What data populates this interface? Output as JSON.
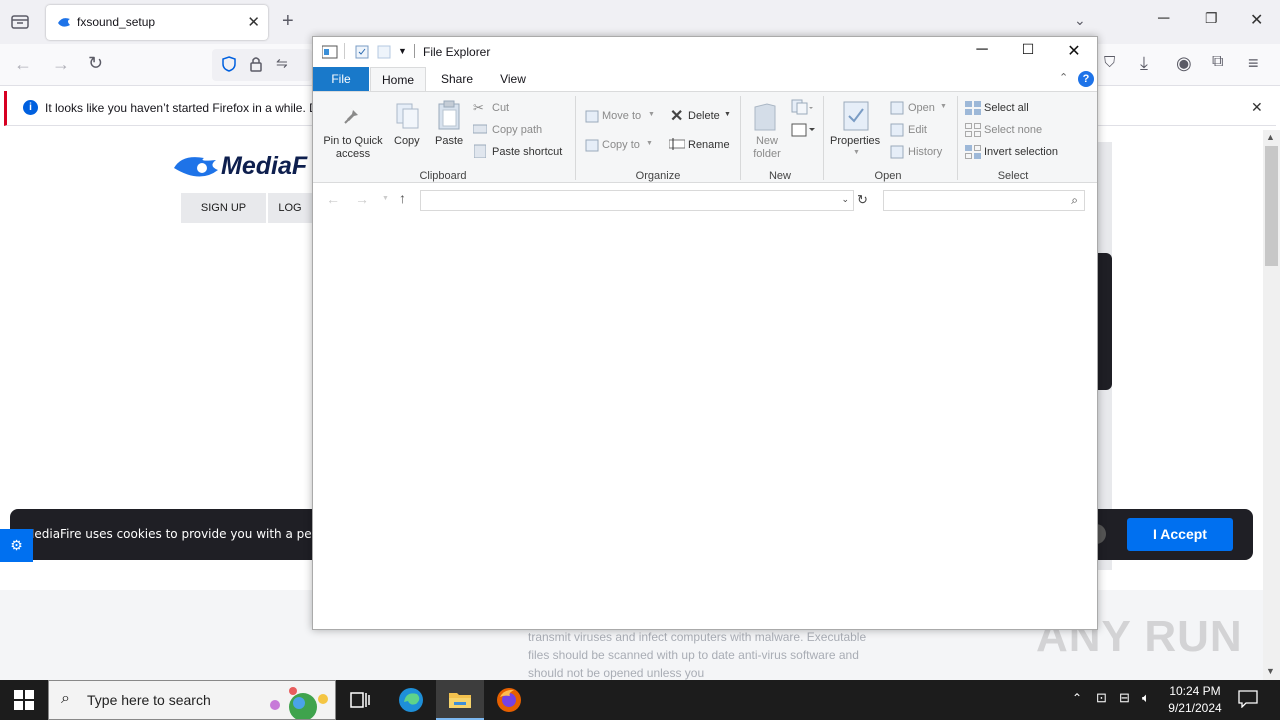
{
  "browser": {
    "tab_title": "fxsound_setup",
    "notification_text": "It looks like you haven’t started Firefox in a while. D"
  },
  "page": {
    "logo_text": "MediaF",
    "signup": "SIGN UP",
    "login": "LOG",
    "cookie_text": "MediaFire uses cookies to provide you with a pers",
    "accept": "I Accept",
    "malware_text": "transmit viruses and infect computers with malware. Executable files should be scanned with up to date anti-virus software and should not be opened unless you",
    "watermark": "ANY RUN"
  },
  "explorer": {
    "title": "File Explorer",
    "tabs": [
      "File",
      "Home",
      "Share",
      "View"
    ],
    "clipboard": {
      "pin": "Pin to Quick access",
      "copy": "Copy",
      "paste": "Paste",
      "cut": "Cut",
      "copy_path": "Copy path",
      "paste_shortcut": "Paste shortcut",
      "group": "Clipboard"
    },
    "organize": {
      "move_to": "Move to",
      "copy_to": "Copy to",
      "delete": "Delete",
      "rename": "Rename",
      "group": "Organize"
    },
    "new": {
      "new_folder": "New folder",
      "group": "New"
    },
    "open": {
      "properties": "Properties",
      "open": "Open",
      "edit": "Edit",
      "history": "History",
      "group": "Open"
    },
    "select": {
      "select_all": "Select all",
      "select_none": "Select none",
      "invert": "Invert selection",
      "group": "Select"
    }
  },
  "taskbar": {
    "search_placeholder": "Type here to search",
    "time": "10:24 PM",
    "date": "9/21/2024"
  }
}
